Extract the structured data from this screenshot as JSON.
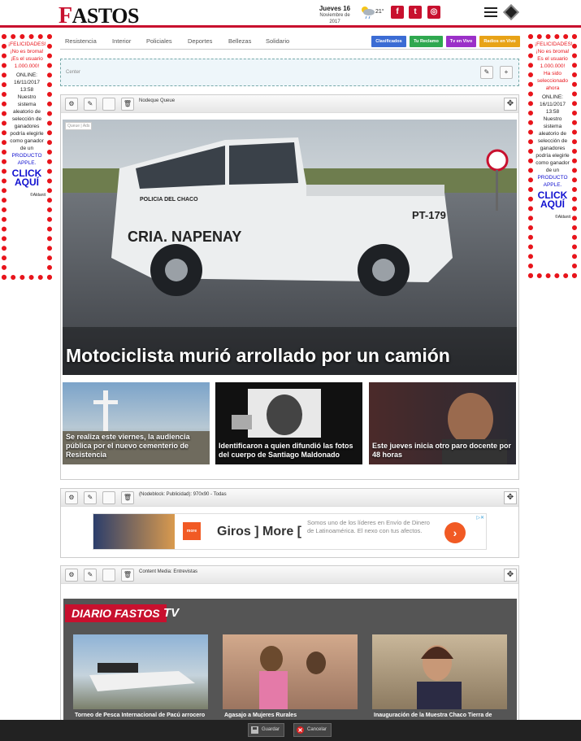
{
  "header": {
    "logo_first": "F",
    "logo_rest": "ASTOS",
    "date_day": "Jueves 16",
    "date_sub": "Noviembre de 2017",
    "temperature": "21°",
    "weather_icon": "partly-cloudy-rain-icon",
    "social": [
      {
        "name": "facebook-icon",
        "glyph": "f"
      },
      {
        "name": "twitter-icon",
        "glyph": "t"
      },
      {
        "name": "instagram-icon",
        "glyph": "◎"
      }
    ],
    "accent_color": "#c8102e"
  },
  "side_ad_left": {
    "line1": "¡FELICIDADES!",
    "line2": "¡No es broma!",
    "line3": "¡Es el usuario 1.000.000!",
    "online_label": "ONLINE:",
    "online_date": "16/11/2017",
    "online_time": "13:58",
    "body": "Nuestro sistema aleatorio de selección de ganadores podría elegirle como ganador de un",
    "product": "PRODUCTO APPLE.",
    "click": "CLICK AQUÍ",
    "credit": "©Aldanit"
  },
  "side_ad_right": {
    "line1": "¡FELICIDADES!",
    "line2": "¡No es broma!",
    "line3": "Es el usuario 1.000.000!",
    "line4": "Ha sido seleccionado ahora",
    "online_label": "ONLINE:",
    "online_date": "16/11/2017",
    "online_time": "13:58",
    "body": "Nuestro sistema aleatorio de selección de ganadores podría elegirle como ganador de un",
    "product": "PRODUCTO APPLE.",
    "click": "CLICK AQUÍ",
    "credit": "©Aldanit"
  },
  "nav": {
    "items": [
      "Resistencia",
      "Interior",
      "Policiales",
      "Deportes",
      "Bellezas",
      "Solidario"
    ],
    "buttons": [
      {
        "label": "Clasificados",
        "color": "#3b6cd4"
      },
      {
        "label": "Tu Reclamo",
        "color": "#2fa84f"
      },
      {
        "label": "Tv en Vivo",
        "color": "#9b30c8"
      },
      {
        "label": "Radios en Vivo",
        "color": "#e8a317"
      }
    ]
  },
  "center_region": {
    "label": "Center"
  },
  "queue_block": {
    "title": "Nodeque Queue",
    "queue_tag": "Queue | Ads",
    "hero_title": "Motociclista murió arrollado por un camión",
    "thumbs": [
      "Se realiza este viernes, la audiencia pública por el nuevo cementerio de Resistencia",
      "Identificaron a quien difundió las fotos del cuerpo de Santiago Maldonado",
      "Este jueves inicia otro paro docente por 48 horas"
    ]
  },
  "ad_block": {
    "title": "(Nodeblock: Publicidad): 970x90 - Todas",
    "brand": "Giros ] More [",
    "text": "Somos uno de los líderes en Envío de Dinero de Latinoamérica. El nexo con tus afectos.",
    "logo_text": "more",
    "arrow": "›"
  },
  "media_block": {
    "title": "Content Media: Entrevistas",
    "badge": "DIARIO FASTOS",
    "tv": "TV",
    "captions": [
      "Torneo de Pesca Internacional de Pacú arrocero",
      "Agasajo a Mujeres Rurales",
      "Inauguración de la Muestra Chaco Tierra de"
    ]
  },
  "bottom_bar": {
    "save": "Guardar",
    "cancel": "Cancelar"
  }
}
